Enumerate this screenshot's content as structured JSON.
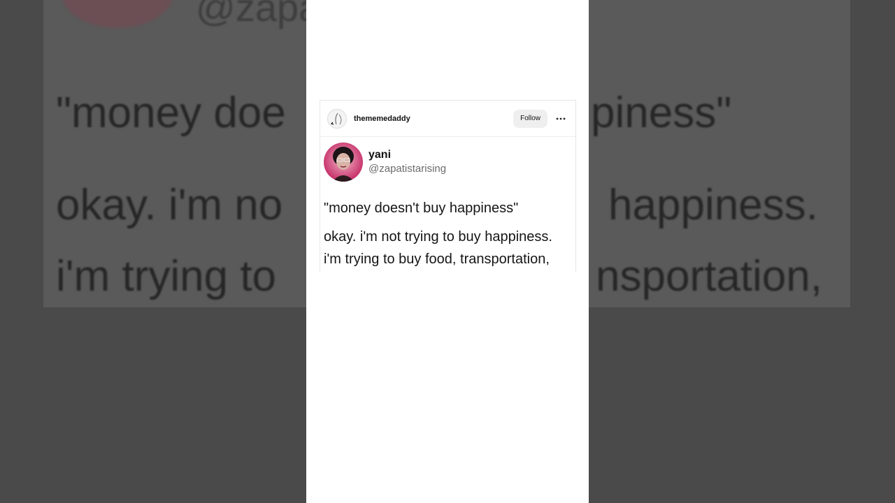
{
  "post": {
    "username": "thememedaddy",
    "follow_label": "Follow",
    "more_label": "···"
  },
  "tweet": {
    "name": "yani",
    "handle": "@zapatistarising",
    "line1": "\"money doesn't buy happiness\"",
    "line2": "okay. i'm not trying to buy happiness.",
    "line3": "i'm trying to buy food, transportation,"
  },
  "background": {
    "line1a": "\"money doe",
    "line1b": "piness\"",
    "line2a": "okay. i'm no",
    "line2b": "happiness.",
    "line3a": "i'm trying to",
    "line3b": "nsportation,",
    "handle": "@zapa"
  },
  "colors": {
    "page_bg": "#4a4a4a",
    "card_bg": "#ffffff",
    "follow_bg": "#efefef",
    "handle_text": "#6b6b6b",
    "avatar_accent": "#d9326e"
  },
  "icons": {
    "more": "more-horizontal-icon",
    "avatar": "profile-avatar-icon"
  }
}
